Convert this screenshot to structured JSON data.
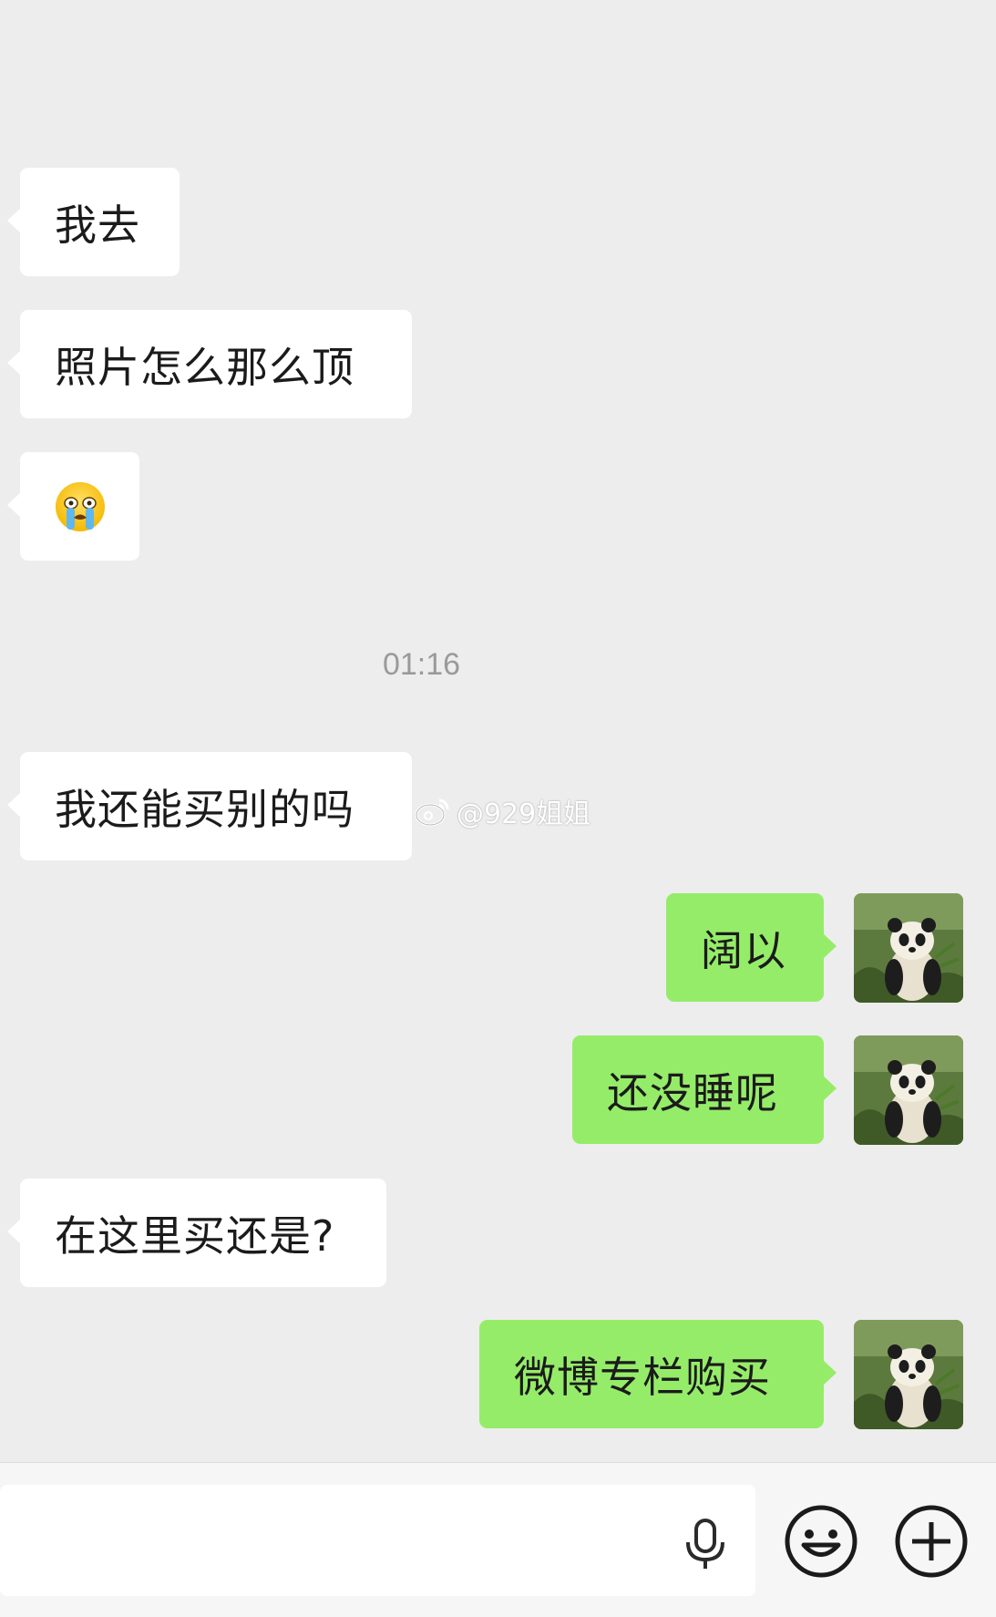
{
  "messages": [
    {
      "side": "in",
      "text": "我去"
    },
    {
      "side": "in",
      "text": "照片怎么那么顶"
    },
    {
      "side": "in",
      "emoji": "loudly-crying-face"
    },
    {
      "side": "in",
      "text": "我还能买别的吗"
    },
    {
      "side": "out",
      "text": "阔以"
    },
    {
      "side": "out",
      "text": "还没睡呢"
    },
    {
      "side": "in",
      "text": "在这里买还是?"
    },
    {
      "side": "out",
      "text": "微博专栏购买"
    }
  ],
  "timestamp": "01:16",
  "watermark": "@929姐姐",
  "avatar": {
    "icon": "panda-avatar"
  },
  "composer": {
    "input_value": "",
    "icons": [
      "microphone-icon",
      "emoji-icon",
      "add-icon"
    ]
  },
  "colors": {
    "background": "#ededed",
    "incoming_bubble": "#ffffff",
    "outgoing_bubble": "#95ec69"
  }
}
